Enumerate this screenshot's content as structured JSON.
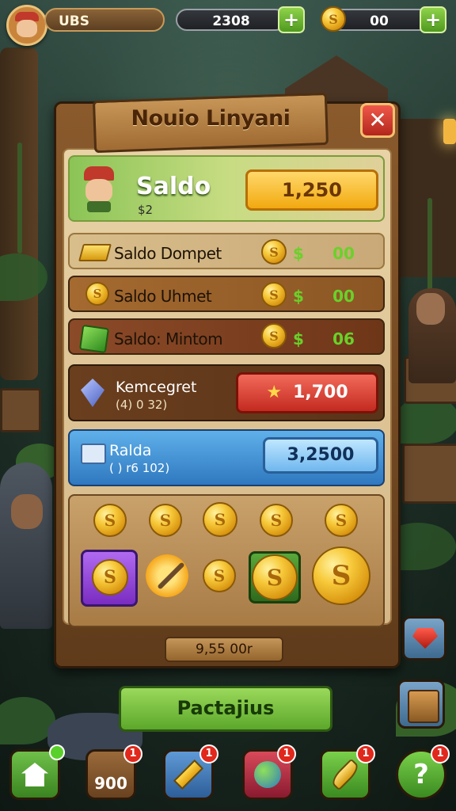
{
  "top_bar": {
    "player_name": "UBS",
    "resource_1_value": "2308",
    "resource_2_value": "00",
    "plus_label": "+"
  },
  "panel": {
    "title": "Nouio Linyani",
    "close_label": "✕",
    "balance": {
      "label": "Saldo",
      "sub": "$2",
      "amount": "1,250"
    },
    "rows": [
      {
        "label": "Saldo Dompet",
        "symbol": "$",
        "value": "00",
        "icon": "gold-bar-icon"
      },
      {
        "label": "Saldo Uhmet",
        "symbol": "$",
        "value": "00",
        "icon": "coin-stack-icon"
      },
      {
        "label": "Saldo: Mintom",
        "symbol": "$",
        "value": "06",
        "icon": "emerald-gem-icon"
      }
    ],
    "gem_row": {
      "label": "Kemcegret",
      "sub": "(4) 0  32)",
      "amount": "1,700"
    },
    "blue_row": {
      "label": "Ralda",
      "sub": "( ) r6 102)",
      "amount": "3,2500"
    },
    "coin_glyph": "S",
    "footer_strip": "9,55 00r"
  },
  "cta": {
    "label": "Pactajius"
  },
  "nav": {
    "items": [
      {
        "name": "home",
        "badge": "",
        "label": ""
      },
      {
        "name": "inventory",
        "badge": "1",
        "label": "900"
      },
      {
        "name": "build",
        "badge": "1",
        "label": ""
      },
      {
        "name": "world",
        "badge": "1",
        "label": ""
      },
      {
        "name": "shop",
        "badge": "1",
        "label": ""
      },
      {
        "name": "help",
        "badge": "1",
        "label": ""
      }
    ]
  },
  "colors": {
    "panel_wood": "#8a5a2c",
    "green_accent": "#6ad12a",
    "red_pill": "#d8352c",
    "blue_row": "#3f8fd0",
    "gold_pill": "#f5b820"
  }
}
